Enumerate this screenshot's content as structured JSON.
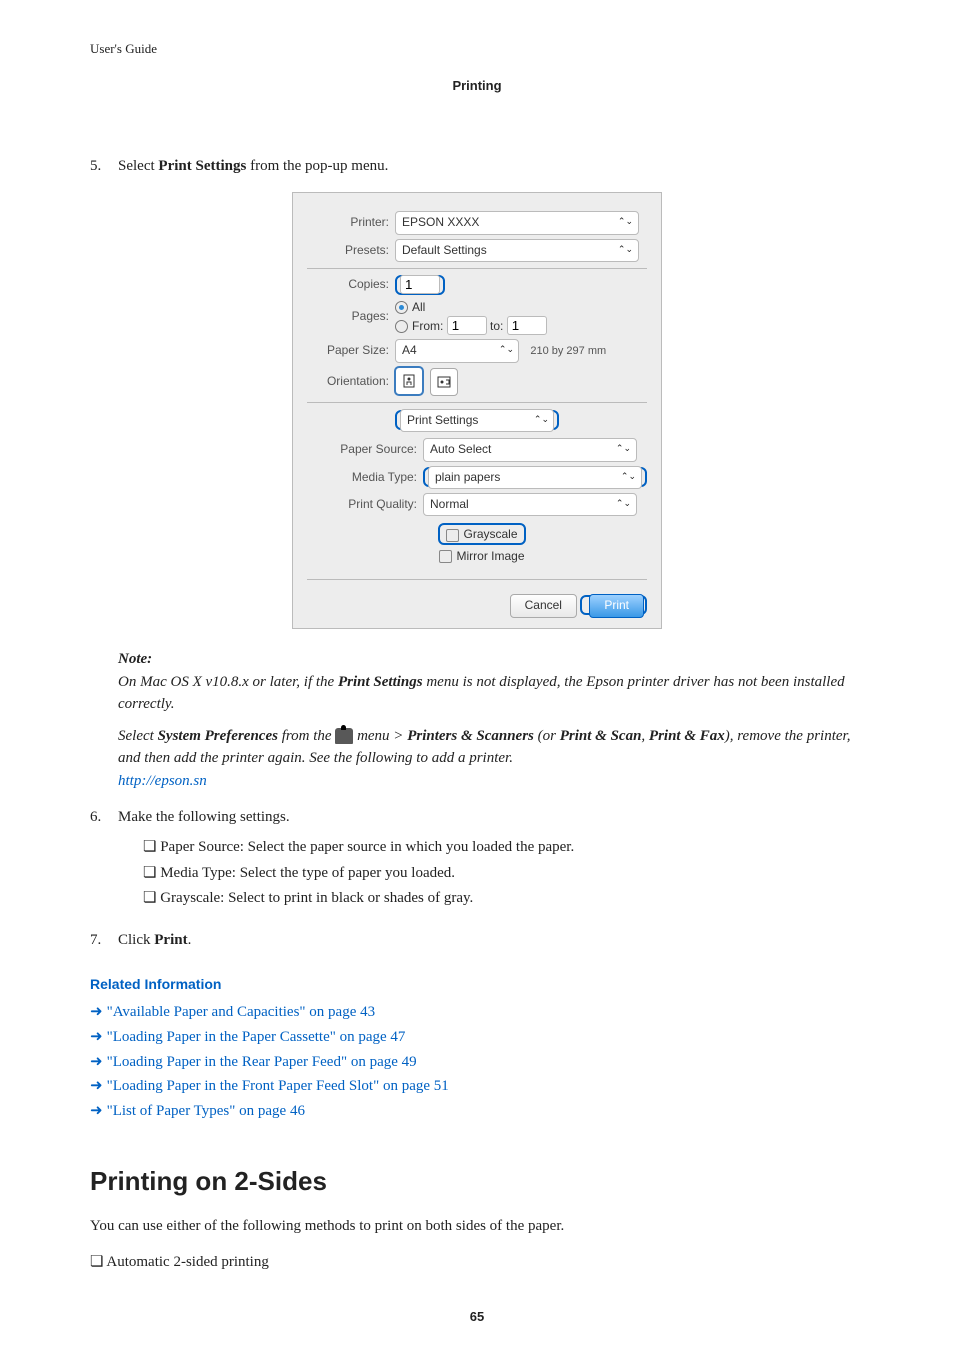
{
  "header": {
    "guide": "User's Guide",
    "center": "Printing"
  },
  "step5": {
    "num": "5.",
    "text_pre": "Select ",
    "bold": "Print Settings",
    "text_post": " from the pop-up menu."
  },
  "dialog": {
    "printer_label": "Printer:",
    "printer_val": "EPSON XXXX",
    "presets_label": "Presets:",
    "presets_val": "Default Settings",
    "copies_label": "Copies:",
    "copies_val": "1",
    "pages_label": "Pages:",
    "pages_all": "All",
    "pages_from": "From:",
    "pages_from_val": "1",
    "pages_to": "to:",
    "pages_to_val": "1",
    "papersize_label": "Paper Size:",
    "papersize_val": "A4",
    "paper_dim": "210 by 297 mm",
    "orientation_label": "Orientation:",
    "popup_val": "Print Settings",
    "paper_source_label": "Paper Source:",
    "paper_source_val": "Auto Select",
    "media_type_label": "Media Type:",
    "media_type_val": "plain papers",
    "print_quality_label": "Print Quality:",
    "print_quality_val": "Normal",
    "grayscale": "Grayscale",
    "mirror": "Mirror Image",
    "cancel": "Cancel",
    "print": "Print"
  },
  "note": {
    "head": "Note:",
    "line1a": "On Mac OS X v10.8.x or later, if the ",
    "line1b": "Print Settings",
    "line1c": " menu is not displayed, the Epson printer driver has not been installed correctly.",
    "line2a": "Select ",
    "line2b": "System Preferences",
    "line2c": " from the ",
    "line2d": " menu > ",
    "line2e": "Printers & Scanners",
    "line2f": " (or ",
    "line2g": "Print & Scan",
    "line2h": ", ",
    "line2i": "Print & Fax",
    "line2j": "), remove the printer, and then add the printer again. See the following to add a printer.",
    "link": "http://epson.sn"
  },
  "step6": {
    "num": "6.",
    "text": "Make the following settings.",
    "b1": "Paper Source: Select the paper source in which you loaded the paper.",
    "b2": "Media Type: Select the type of paper you loaded.",
    "b3": "Grayscale: Select to print in black or shades of gray."
  },
  "step7": {
    "num": "7.",
    "pre": "Click ",
    "bold": "Print",
    "post": "."
  },
  "related": {
    "head": "Related Information",
    "r1": "\"Available Paper and Capacities\" on page 43",
    "r2": "\"Loading Paper in the Paper Cassette\" on page 47",
    "r3": "\"Loading Paper in the Rear Paper Feed\" on page 49",
    "r4": "\"Loading Paper in the Front Paper Feed Slot\" on page 51",
    "r5": "\"List of Paper Types\" on page 46"
  },
  "h2": "Printing on 2-Sides",
  "h2_sub": "You can use either of the following methods to print on both sides of the paper.",
  "h2_b1": "Automatic 2-sided printing",
  "pagenum": "65"
}
